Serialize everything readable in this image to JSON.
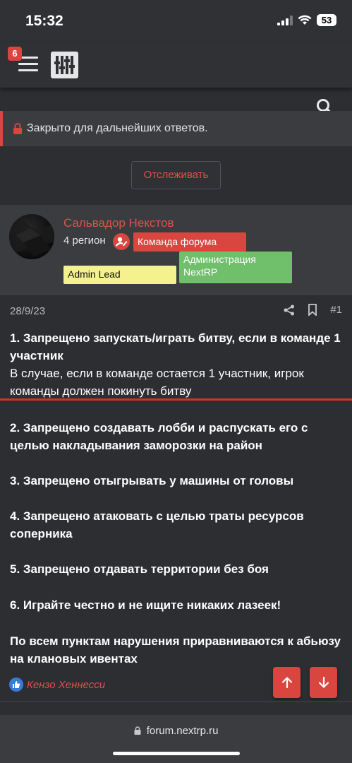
{
  "status_bar": {
    "time": "15:32",
    "battery": "53",
    "icons": [
      "signal-icon",
      "wifi-icon",
      "battery-icon"
    ]
  },
  "navbar": {
    "notification_count": "6",
    "icons": [
      "menu-icon",
      "logo-icon",
      "search-icon"
    ]
  },
  "notice": {
    "text": "Закрыто для дальнейших ответов.",
    "icon": "lock-icon"
  },
  "follow_button": {
    "label": "Отслеживать"
  },
  "author": {
    "name": "Сальвадор Некстов",
    "title": "4 регион",
    "banners": [
      {
        "label": "Команда форума",
        "color": "#d9453f"
      },
      {
        "label": "Admin Lead",
        "color": "#f5f18e"
      },
      {
        "label": "Администрация NextRP",
        "color": "#6fbf6b"
      }
    ]
  },
  "post": {
    "date": "28/9/23",
    "number": "#1",
    "paragraphs": [
      {
        "bold": "1. Запрещено запускать/играть битву, если в команде 1 участник",
        "normal": "В случае, если в команде остается 1 участник, игрок команды должен покинуть битву"
      },
      {
        "bold": "2. Запрещено создавать лобби и распускать его с целью накладывания заморозки на район"
      },
      {
        "bold": "3. Запрещено отыгрывать у машины от головы"
      },
      {
        "bold": "4. Запрещено атаковать с целью траты ресурсов соперника"
      },
      {
        "bold": "5. Запрещено отдавать территории без боя"
      },
      {
        "bold": "6. Играйте честно и не ищите никаких лазеек!"
      },
      {
        "bold": "По всем пунктам нарушения приравниваются к абьюзу на клановых ивентах"
      }
    ],
    "reactions": {
      "user": "Кензо Хеннесси",
      "icon": "like-icon"
    }
  },
  "footer": {
    "url": "forum.nextrp.ru"
  },
  "colors": {
    "accent": "#d9453f",
    "background": "#2c2e32",
    "panel": "#3a3c40"
  }
}
